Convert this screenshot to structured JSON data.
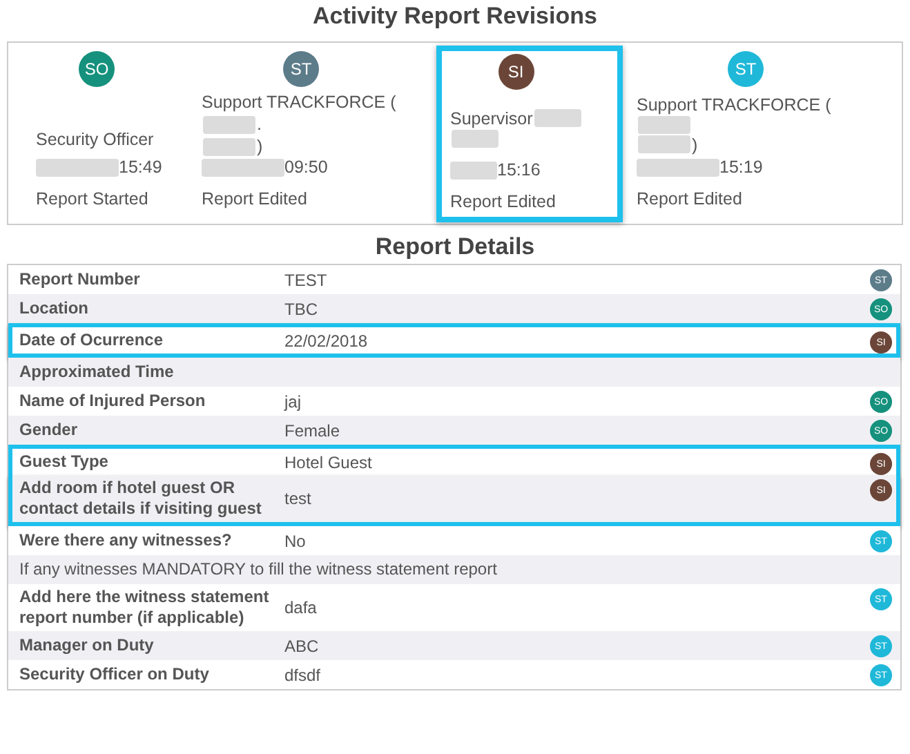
{
  "revisions_title": "Activity Report Revisions",
  "revisions": [
    {
      "initials": "SO",
      "color": "#15917d",
      "highlighted": false,
      "name_parts": [
        {
          "kind": "text",
          "text": "Security Officer"
        }
      ],
      "time": "15:49",
      "action": "Report Started"
    },
    {
      "initials": "ST",
      "color": "#5c7c8a",
      "highlighted": false,
      "name_parts": [
        {
          "kind": "text",
          "text": "Support TRACKFORCE ("
        },
        {
          "kind": "redacted"
        },
        {
          "kind": "text",
          "text": "."
        },
        {
          "kind": "break"
        },
        {
          "kind": "redacted"
        },
        {
          "kind": "text",
          "text": ")"
        }
      ],
      "time": "09:50",
      "action": "Report Edited"
    },
    {
      "initials": "SI",
      "color": "#6b4638",
      "highlighted": true,
      "name_parts": [
        {
          "kind": "text",
          "text": "Supervisor"
        },
        {
          "kind": "redacted"
        },
        {
          "kind": "break"
        },
        {
          "kind": "redacted"
        }
      ],
      "time": "15:16",
      "action": "Report Edited"
    },
    {
      "initials": "ST",
      "color": "#1fb8d8",
      "highlighted": false,
      "name_parts": [
        {
          "kind": "text",
          "text": "Support TRACKFORCE ("
        },
        {
          "kind": "redacted"
        },
        {
          "kind": "break"
        },
        {
          "kind": "redacted"
        },
        {
          "kind": "text",
          "text": ")"
        }
      ],
      "time": "15:19",
      "action": "Report Edited"
    }
  ],
  "details_title": "Report Details",
  "rows": [
    {
      "kind": "field",
      "label": "Report Number",
      "value": "TEST",
      "initials": "ST",
      "color": "#5c7c8a",
      "highlighted": false
    },
    {
      "kind": "field",
      "label": "Location",
      "value": "TBC",
      "initials": "SO",
      "color": "#15917d",
      "highlighted": false
    },
    {
      "kind": "field",
      "label": "Date of Ocurrence",
      "value": "22/02/2018",
      "initials": "SI",
      "color": "#6b4638",
      "highlighted": true
    },
    {
      "kind": "field",
      "label": "Approximated Time",
      "highlighted": false
    },
    {
      "kind": "field",
      "label": "Name of Injured Person",
      "value": "jaj",
      "initials": "SO",
      "color": "#15917d",
      "highlighted": false
    },
    {
      "kind": "field",
      "label": "Gender",
      "value": "Female",
      "initials": "SO",
      "color": "#15917d",
      "highlighted": false
    },
    {
      "kind": "field",
      "label": "Guest Type",
      "value": "Hotel Guest",
      "initials": "SI",
      "color": "#6b4638",
      "highlighted": true
    },
    {
      "kind": "field",
      "label": "Add room if hotel guest OR contact details if visiting guest",
      "value": "test",
      "initials": "SI",
      "color": "#6b4638",
      "highlighted": true
    },
    {
      "kind": "field",
      "label": "Were there any witnesses?",
      "value": "No",
      "initials": "ST",
      "color": "#1fb8d8",
      "highlighted": false
    },
    {
      "kind": "note",
      "label": "If any witnesses MANDATORY to fill the witness statement report",
      "highlighted": false
    },
    {
      "kind": "field",
      "label": "Add here the witness statement report number (if applicable)",
      "value": "dafa",
      "initials": "ST",
      "color": "#1fb8d8",
      "highlighted": false
    },
    {
      "kind": "field",
      "label": "Manager on Duty",
      "value": "ABC",
      "initials": "ST",
      "color": "#1fb8d8",
      "highlighted": false
    },
    {
      "kind": "field",
      "label": "Security Officer on Duty",
      "value": "dfsdf",
      "initials": "ST",
      "color": "#1fb8d8",
      "highlighted": false
    }
  ]
}
